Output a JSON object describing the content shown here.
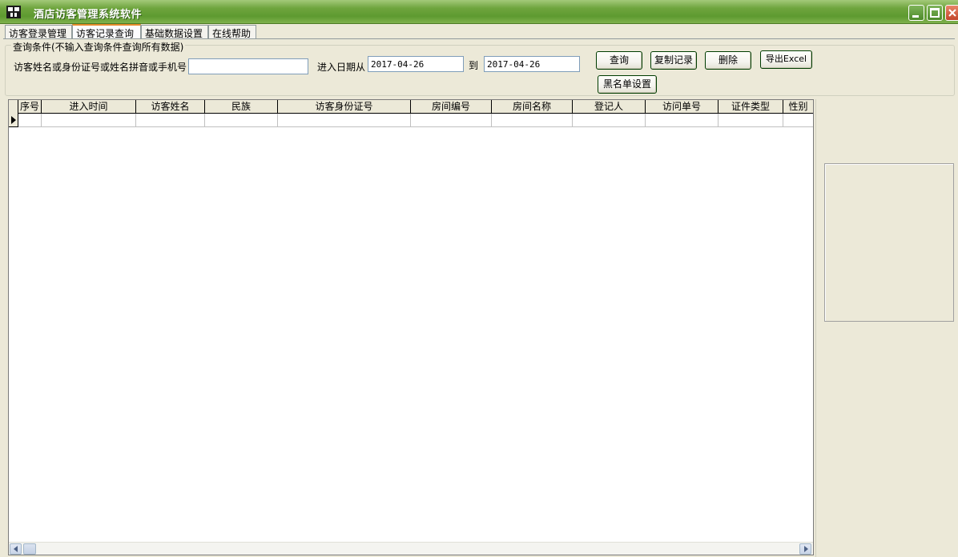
{
  "window": {
    "title": "酒店访客管理系统软件"
  },
  "tabs": [
    {
      "label": "访客登录管理",
      "active": false
    },
    {
      "label": "访客记录查询",
      "active": true
    },
    {
      "label": "基础数据设置",
      "active": false
    },
    {
      "label": "在线帮助",
      "active": false
    }
  ],
  "query": {
    "group_title": "查询条件(不输入查询条件查询所有数据)",
    "name_label": "访客姓名或身份证号或姓名拼音或手机号",
    "name_value": "",
    "date_from_label": "进入日期从",
    "date_from": "2017-04-26",
    "date_to_label": "到",
    "date_to": "2017-04-26"
  },
  "buttons": {
    "query": "查询",
    "copy": "复制记录",
    "delete": "删除",
    "export": "导出Excel",
    "blacklist": "黑名单设置"
  },
  "grid": {
    "columns": [
      "序号",
      "进入时间",
      "访客姓名",
      "民族",
      "访客身份证号",
      "房间编号",
      "房间名称",
      "登记人",
      "访问单号",
      "证件类型",
      "性别"
    ],
    "rows": []
  },
  "colors": {
    "titlebar": "#6fa53e",
    "face": "#ece9d8",
    "active_tab_accent": "#e68b2c"
  },
  "icons": [
    "app-icon",
    "minimize-icon",
    "maximize-icon",
    "close-icon",
    "row-indicator-icon",
    "scroll-left-icon",
    "scroll-right-icon"
  ]
}
